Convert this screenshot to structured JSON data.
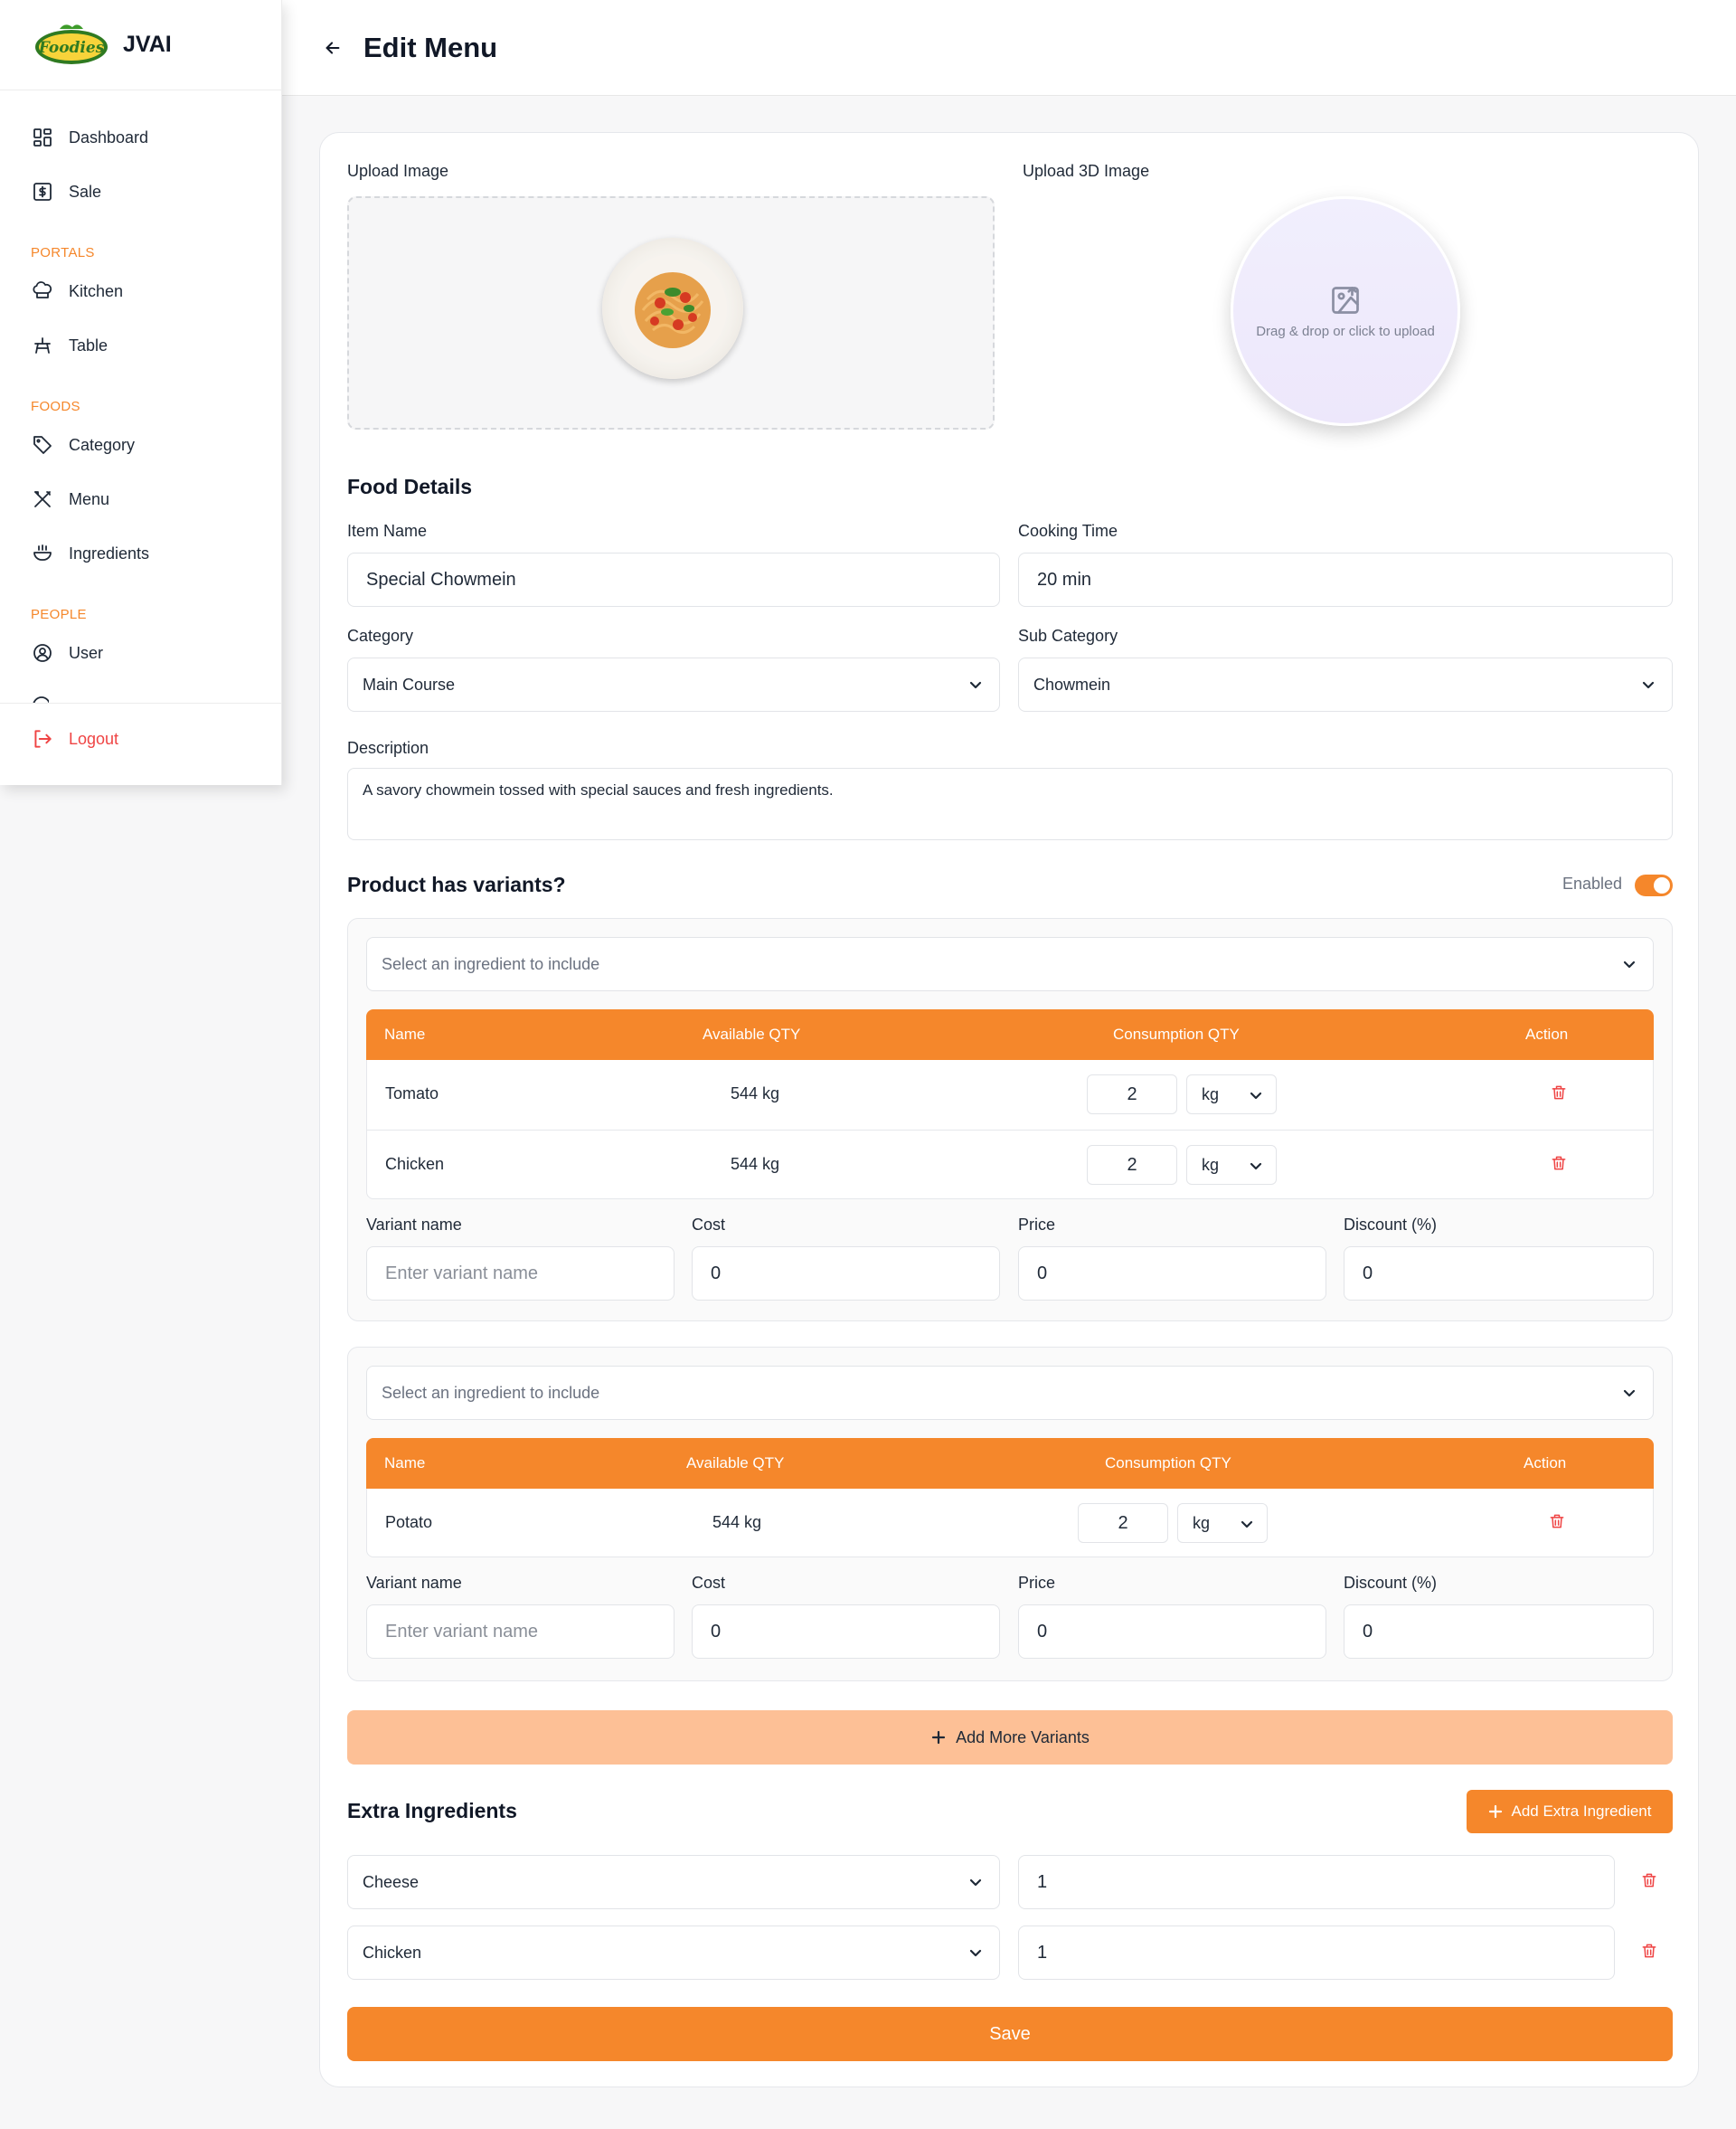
{
  "brand": {
    "name": "JVAI",
    "logo_text": "Foodies"
  },
  "sidebar": {
    "items_top": [
      {
        "label": "Dashboard",
        "icon": "dashboard-icon"
      },
      {
        "label": "Sale",
        "icon": "dollar-icon"
      }
    ],
    "sections": [
      {
        "title": "PORTALS",
        "items": [
          {
            "label": "Kitchen",
            "icon": "chef-hat-icon"
          },
          {
            "label": "Table",
            "icon": "table-icon"
          }
        ]
      },
      {
        "title": "FOODS",
        "items": [
          {
            "label": "Category",
            "icon": "tag-icon"
          },
          {
            "label": "Menu",
            "icon": "utensils-icon"
          },
          {
            "label": "Ingredients",
            "icon": "ingredients-icon"
          }
        ]
      },
      {
        "title": "PEOPLE",
        "items": [
          {
            "label": "User",
            "icon": "user-circle-icon"
          }
        ]
      }
    ],
    "logout_label": "Logout"
  },
  "header": {
    "title": "Edit Menu"
  },
  "upload": {
    "image_label": "Upload Image",
    "image3d_label": "Upload 3D Image",
    "image3d_hint": "Drag & drop or click to upload"
  },
  "food_details": {
    "title": "Food Details",
    "item_name_label": "Item Name",
    "item_name_value": "Special Chowmein",
    "cooking_time_label": "Cooking Time",
    "cooking_time_value": "20 min",
    "category_label": "Category",
    "category_value": "Main Course",
    "subcategory_label": "Sub Category",
    "subcategory_value": "Chowmein",
    "description_label": "Description",
    "description_value": "A savory chowmein tossed with special sauces and fresh ingredients."
  },
  "variants": {
    "title": "Product has variants?",
    "toggle_label": "Enabled",
    "enabled": true,
    "ingredient_placeholder": "Select an ingredient to include",
    "columns": [
      "Name",
      "Available QTY",
      "Consumption QTY",
      "Action"
    ],
    "variant_name_label": "Variant name",
    "variant_name_placeholder": "Enter variant name",
    "cost_label": "Cost",
    "price_label": "Price",
    "discount_label": "Discount (%)",
    "groups": [
      {
        "rows": [
          {
            "name": "Tomato",
            "available": "544 kg",
            "qty": "2",
            "unit": "kg"
          },
          {
            "name": "Chicken",
            "available": "544 kg",
            "qty": "2",
            "unit": "kg"
          }
        ],
        "cost": "0",
        "price": "0",
        "discount": "0"
      },
      {
        "rows": [
          {
            "name": "Potato",
            "available": "544 kg",
            "qty": "2",
            "unit": "kg"
          }
        ],
        "cost": "0",
        "price": "0",
        "discount": "0"
      }
    ],
    "add_more_label": "Add More Variants"
  },
  "extras": {
    "title": "Extra Ingredients",
    "add_label": "Add Extra Ingredient",
    "items": [
      {
        "name": "Cheese",
        "qty": "1"
      },
      {
        "name": "Chicken",
        "qty": "1"
      }
    ]
  },
  "save_label": "Save",
  "colors": {
    "accent": "#f5872b",
    "accent_light": "#fdc096",
    "danger": "#ef4444"
  }
}
